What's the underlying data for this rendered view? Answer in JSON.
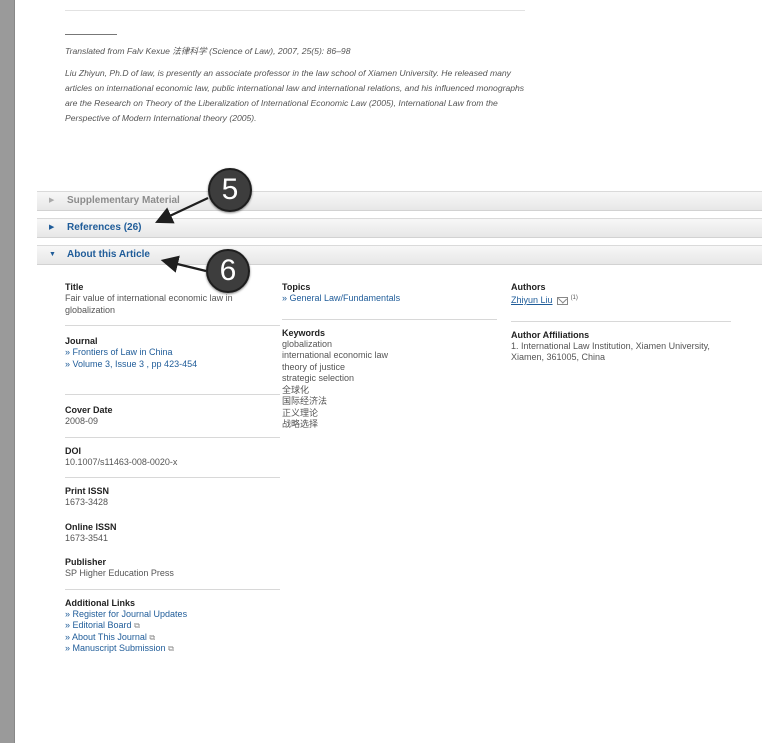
{
  "notes": {
    "translated": "Translated from Falv Kexue 法律科学 (Science of Law), 2007, 25(5): 86–98",
    "bio": "Liu Zhiyun, Ph.D of law, is presently an associate professor in the law school of Xiamen University. He released many articles on international economic law, public international law and international relations, and his influenced monographs are the Research on Theory of the Liberalization of International Economic Law (2005), International Law from the Perspective of Modern International theory (2005)."
  },
  "sections": {
    "supplementary": "Supplementary Material",
    "references": "References (26)",
    "about": "About this Article"
  },
  "callouts": {
    "five": "5",
    "six": "6"
  },
  "article": {
    "title_label": "Title",
    "title_value": "Fair value of international economic law in globalization",
    "journal_label": "Journal",
    "journal_links": [
      "» Frontiers of Law in China",
      "» Volume 3, Issue 3 , pp 423-454"
    ],
    "cover_date_label": "Cover Date",
    "cover_date": "2008-09",
    "doi_label": "DOI",
    "doi": "10.1007/s11463-008-0020-x",
    "print_issn_label": "Print ISSN",
    "print_issn": "1673-3428",
    "online_issn_label": "Online ISSN",
    "online_issn": "1673-3541",
    "publisher_label": "Publisher",
    "publisher": "SP Higher Education Press",
    "additional_links_label": "Additional Links",
    "additional_links": [
      "» Register for Journal Updates",
      "» Editorial Board",
      "» About This Journal",
      "» Manuscript Submission"
    ],
    "topics_label": "Topics",
    "topics": [
      "» General Law/Fundamentals"
    ],
    "keywords_label": "Keywords",
    "keywords": [
      "globalization",
      "international economic law",
      "theory of justice",
      "strategic selection",
      "全球化",
      "国际经济法",
      "正义理论",
      "战略选择"
    ],
    "authors_label": "Authors",
    "author": "Zhiyun Liu",
    "author_sup": "(1)",
    "affiliations_label": "Author Affiliations",
    "affiliation": "1. International Law Institution, Xiamen University, Xiamen, 361005, China"
  },
  "colors": {
    "link": "#1f5c99",
    "callout": "#3d3d3d"
  },
  "icons": {
    "collapsed": "triangle-right-icon",
    "expanded": "triangle-down-icon",
    "mail": "mail-icon",
    "external": "external-link-icon"
  }
}
